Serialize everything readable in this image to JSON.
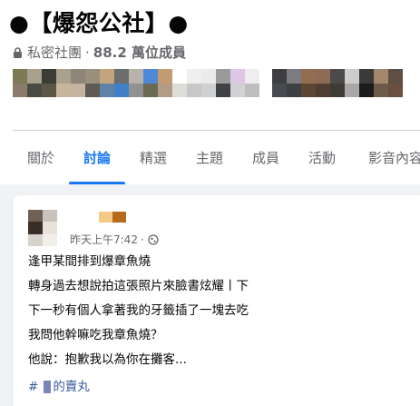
{
  "group": {
    "title": "●【爆怨公社】●",
    "privacy": "私密社團",
    "separator": "·",
    "members": "88.2 萬位成員"
  },
  "avatar_strip_colors": [
    [
      "#7d7a56",
      "#8a7b6a"
    ],
    [
      "#a89f8c",
      "#4a4b43"
    ],
    [
      "#3b3c33",
      "#5b5646"
    ],
    [
      "#aaa08e",
      "#c7b59d"
    ],
    [
      "#8d8577",
      "#c4b4a1"
    ],
    [
      "#9b8f7e",
      "#5f5a53"
    ],
    [
      "#c4a47c",
      "#5f83a8"
    ],
    [
      "#6b6d6e",
      "#3f80c8"
    ],
    [
      "#b7b3ab",
      "#91918f"
    ],
    [
      "#4d89d6",
      "#6b6a53"
    ],
    [
      "#c39b71",
      "#b39b85"
    ],
    [
      "#ffffff",
      "#dedcd6"
    ],
    [
      "#efefef",
      "#c7c7c7"
    ],
    [
      "#ebebeb",
      "#d0d0d0"
    ],
    [
      "#9a9a9a",
      "#3e4245"
    ],
    [
      "#ddc6e6",
      "#d2d2d2"
    ],
    [
      "#eeeeee",
      "#bdbdbd"
    ],
    "gap",
    [
      "#3f3f42",
      "#474a4e"
    ],
    [
      "#7a7c80",
      "#3c3f44"
    ],
    [
      "#926d52",
      "#5d4732"
    ],
    [
      "#8d6b54",
      "#4f3e31"
    ],
    [
      "#4d4b49",
      "#3f3b37"
    ],
    [
      "#cdcdcd",
      "#a8a8a8"
    ],
    [
      "#3a3a3a",
      "#1c1c1c"
    ],
    [
      "#a4876c",
      "#6e5a49"
    ],
    [
      "#5e4e44",
      "#6a4f3e"
    ]
  ],
  "tabs": [
    {
      "label": "關於",
      "active": false
    },
    {
      "label": "討論",
      "active": true
    },
    {
      "label": "精選",
      "active": false
    },
    {
      "label": "主題",
      "active": false
    },
    {
      "label": "成員",
      "active": false
    },
    {
      "label": "活動",
      "active": false
    },
    {
      "label": "影音內容",
      "active": false
    }
  ],
  "post": {
    "avatar_colors": [
      "#6f6254",
      "#c9c3bb",
      "#3a2f27",
      "#e9e2d9",
      "#d6d2cc",
      "#f2efea"
    ],
    "author_colors": [
      "#f3c985",
      "#b86a1c"
    ],
    "time": "昨天上午7:42",
    "time_separator": "·",
    "lines": [
      "逢甲某間排到爆章魚燒",
      "轉身過去想說拍這張照片來臉書炫耀丨下",
      "下一秒有個人拿著我的牙籤插了一塊去吃",
      "我問他幹嘛吃我章魚燒？",
      "他說：抱歉我以為你在攤客..."
    ],
    "hashtag_symbol": "#",
    "hashtag_text": "的賣丸"
  },
  "colors": {
    "accent": "#1877f2",
    "muted_text": "#65676b",
    "link": "#385898",
    "page_bg": "#f0f2f5"
  }
}
